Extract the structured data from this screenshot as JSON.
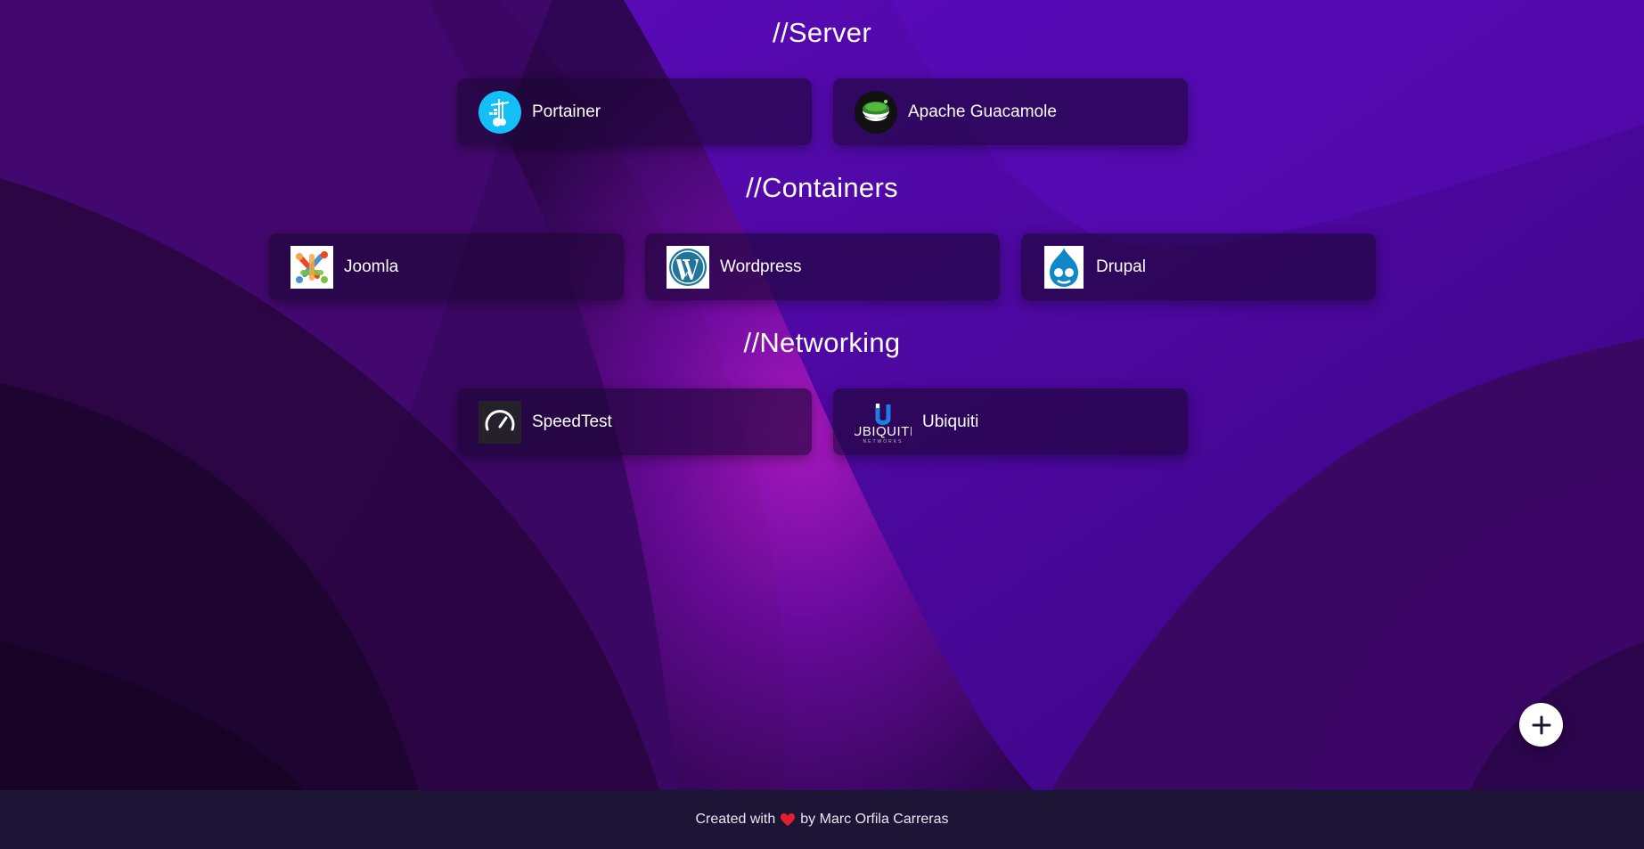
{
  "sections": [
    {
      "title": "//Server",
      "apps": [
        {
          "label": "Portainer",
          "icon": "portainer-icon"
        },
        {
          "label": "Apache Guacamole",
          "icon": "guacamole-icon"
        }
      ]
    },
    {
      "title": "//Containers",
      "apps": [
        {
          "label": "Joomla",
          "icon": "joomla-icon"
        },
        {
          "label": "Wordpress",
          "icon": "wordpress-icon"
        },
        {
          "label": "Drupal",
          "icon": "drupal-icon"
        }
      ]
    },
    {
      "title": "//Networking",
      "apps": [
        {
          "label": "SpeedTest",
          "icon": "speedtest-icon"
        },
        {
          "label": "Ubiquiti",
          "icon": "ubiquiti-icon"
        }
      ]
    }
  ],
  "fab": {
    "icon": "plus-icon"
  },
  "footer": {
    "prefix": "Created with",
    "icon": "heart-icon",
    "suffix": "by Marc Orfila Carreras"
  },
  "colors": {
    "background": "#2a0648",
    "card": "#1c0634",
    "footer": "#1c1535",
    "text": "#ffffff"
  }
}
